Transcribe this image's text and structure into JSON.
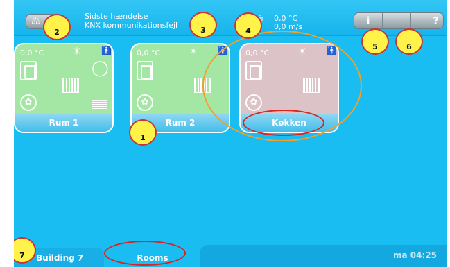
{
  "topbar": {
    "event_title": "Sidste hændelse",
    "event_text": "KNX kommunikationsfejl",
    "weather_label": "Vejr",
    "weather_temp": "0,0 °C",
    "weather_wind": "0,0 m/s",
    "info_label": "i",
    "help_label": "?"
  },
  "rooms": [
    {
      "name": "Rum 1",
      "temp": "0,0 °C",
      "state": "green"
    },
    {
      "name": "Rum 2",
      "temp": "0,0 °C",
      "state": "green"
    },
    {
      "name": "Køkken",
      "temp": "0,0 °C",
      "state": "pink"
    }
  ],
  "bottom": {
    "building_tab": "Building 7",
    "rooms_tab": "Rooms",
    "clock": "ma 04:25"
  },
  "markers": [
    "2",
    "3",
    "4",
    "5",
    "6",
    "1",
    "7"
  ],
  "colors": {
    "background": "#19bdf2",
    "tile_green": "#a4e7a4",
    "tile_pink": "#dcc3c7",
    "marker_fill": "#fff34a",
    "marker_ring": "#d9241f",
    "highlight_ring": "#f0a12a"
  }
}
